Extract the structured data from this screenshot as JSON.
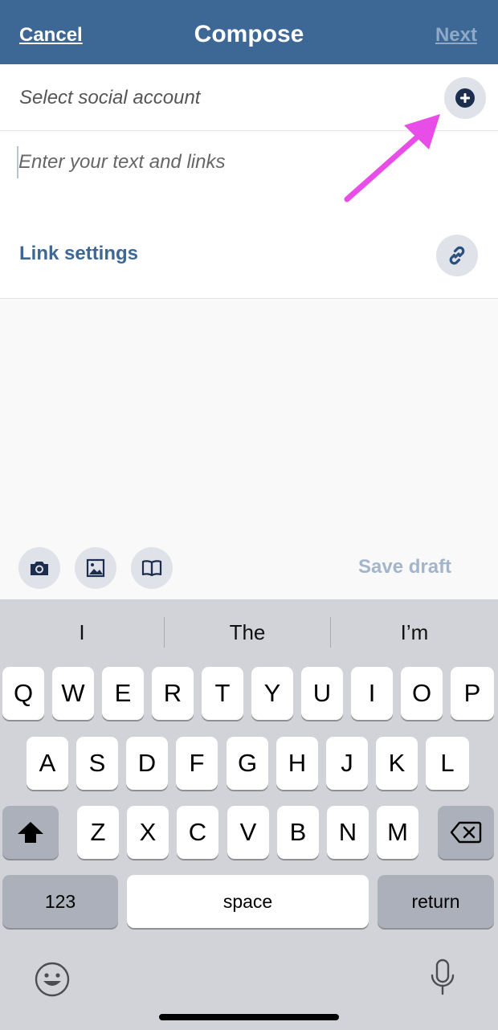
{
  "header": {
    "cancel": "Cancel",
    "title": "Compose",
    "next": "Next"
  },
  "account": {
    "placeholder": "Select social account",
    "add_icon": "plus-circle-icon"
  },
  "composer": {
    "placeholder": "Enter your text and links",
    "value": ""
  },
  "link_settings": {
    "label": "Link settings",
    "icon": "link-icon"
  },
  "media": {
    "camera_icon": "camera-icon",
    "image_icon": "image-icon",
    "library_icon": "book-icon",
    "save_draft": "Save draft"
  },
  "keyboard": {
    "suggestions": [
      "I",
      "The",
      "I’m"
    ],
    "row1": [
      "Q",
      "W",
      "E",
      "R",
      "T",
      "Y",
      "U",
      "I",
      "O",
      "P"
    ],
    "row2": [
      "A",
      "S",
      "D",
      "F",
      "G",
      "H",
      "J",
      "K",
      "L"
    ],
    "row3": [
      "Z",
      "X",
      "C",
      "V",
      "B",
      "N",
      "M"
    ],
    "numbers": "123",
    "space": "space",
    "return": "return"
  },
  "colors": {
    "header_bg": "#3d6895",
    "accent": "#3d6895",
    "annotation_arrow": "#e94de8"
  }
}
